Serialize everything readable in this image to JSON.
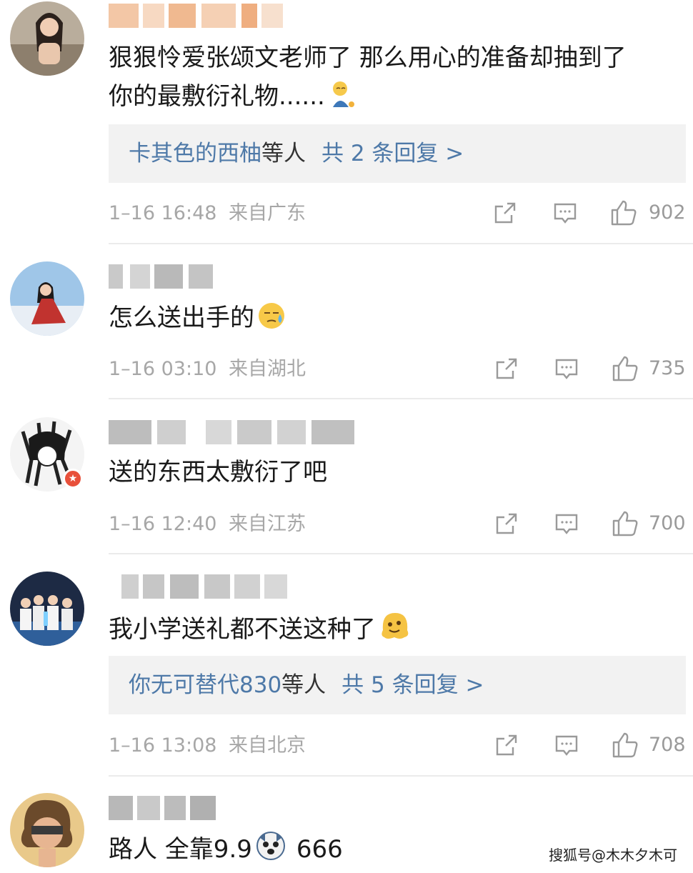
{
  "comments": [
    {
      "text_line1": "狠狠怜爱张颂文老师了 那么用心的准备却抽到了",
      "text_line2": "你的最敷衍礼物......",
      "emoji": "sitting-emoji-icon",
      "replies": {
        "names": "卡其色的西柚",
        "suffix": "等人",
        "count_text": "共 2 条回复 >"
      },
      "date": "1–16 16:48",
      "location": "来自广东",
      "likes": "902"
    },
    {
      "text_line1": "怎么送出手的",
      "emoji": "sweat-face-icon",
      "date": "1–16 03:10",
      "location": "来自湖北",
      "likes": "735"
    },
    {
      "text_line1": "送的东西太敷衍了吧",
      "date": "1–16 12:40",
      "location": "来自江苏",
      "likes": "700"
    },
    {
      "text_line1": "我小学送礼都不送这种了",
      "emoji": "melting-face-icon",
      "replies": {
        "names": "你无可替代830",
        "suffix": "等人",
        "count_text": "共 5 条回复 >"
      },
      "date": "1–16 13:08",
      "location": "来自北京",
      "likes": "708"
    },
    {
      "text_part1": "路人 全靠9.9",
      "emoji": "dog-face-icon",
      "text_part2": "666"
    }
  ],
  "watermark": "搜狐号@木木夕木可",
  "colors": {
    "link": "#4e79a8",
    "meta": "#a7a7a7",
    "reply_bg": "#f2f2f2",
    "divider": "#ebebeb"
  }
}
